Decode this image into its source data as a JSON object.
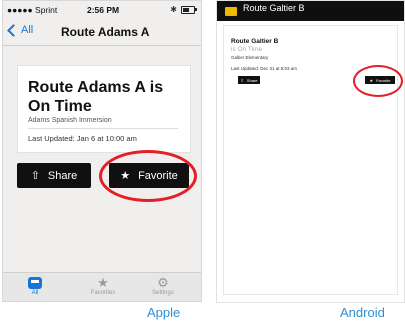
{
  "apple": {
    "status": {
      "carrier": "●●●●● Sprint",
      "time": "2:56 PM"
    },
    "nav": {
      "back_label": "All",
      "title": "Route Adams A"
    },
    "card": {
      "title": "Route Adams A is On Time",
      "school": "Adams Spanish Immersion",
      "updated": "Last Updated: Jan 6 at 10:00 am"
    },
    "buttons": {
      "share": "Share",
      "favorite": "Favorite"
    },
    "tabs": [
      {
        "label": "All"
      },
      {
        "label": "Favorites"
      },
      {
        "label": "Settings"
      }
    ],
    "platform_label": "Apple"
  },
  "android": {
    "header_title": "Route Galtier B",
    "card": {
      "route": "Route Galtier B",
      "status": "is On Time",
      "school": "Galtier Elementary",
      "updated": "Last Updated: Dec 31 at 5:03 am"
    },
    "buttons": {
      "share": "Share",
      "favorite": "Favorite"
    },
    "platform_label": "Android"
  },
  "colors": {
    "accent": "#1576d8",
    "highlight": "#e32027",
    "label": "#2f8fd0"
  }
}
